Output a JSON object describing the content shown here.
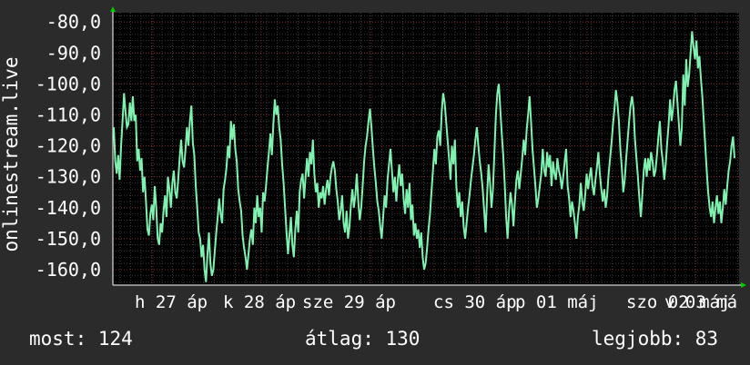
{
  "chart_data": {
    "type": "line",
    "ylabel": "onlinestream.live",
    "ylim": [
      -165,
      -77
    ],
    "y_ticks": [
      "-80,0",
      "-90,0",
      "-100,0",
      "-110,0",
      "-120,0",
      "-130,0",
      "-140,0",
      "-150,0",
      "-160,0"
    ],
    "y_tick_values": [
      -80,
      -90,
      -100,
      -110,
      -120,
      -130,
      -140,
      -150,
      -160
    ],
    "x_tick_labels": [
      "h 27 áp",
      "k 28 áp",
      "sze 29 áp",
      "cs 30 áp",
      "p 01 máj",
      "szo 02 máj",
      "v 03 má"
    ],
    "grid": true,
    "series": [
      {
        "color": "#7ff2b0",
        "values": [
          -114,
          -125,
          -129,
          -123,
          -131,
          -120,
          -112,
          -103,
          -109,
          -114,
          -113,
          -106,
          -112,
          -104,
          -112,
          -110,
          -125,
          -121,
          -128,
          -124,
          -135,
          -130,
          -138,
          -147,
          -149,
          -142,
          -139,
          -144,
          -133,
          -140,
          -150,
          -152,
          -145,
          -148,
          -141,
          -136,
          -143,
          -130,
          -134,
          -140,
          -132,
          -128,
          -135,
          -137,
          -131,
          -124,
          -118,
          -125,
          -127,
          -121,
          -114,
          -120,
          -112,
          -107,
          -119,
          -123,
          -133,
          -140,
          -148,
          -150,
          -156,
          -152,
          -160,
          -164,
          -155,
          -148,
          -158,
          -162,
          -160,
          -154,
          -148,
          -143,
          -137,
          -142,
          -145,
          -134,
          -131,
          -127,
          -120,
          -124,
          -112,
          -118,
          -113,
          -121,
          -125,
          -134,
          -138,
          -141,
          -149,
          -153,
          -156,
          -160,
          -155,
          -150,
          -147,
          -152,
          -140,
          -145,
          -136,
          -143,
          -140,
          -148,
          -135,
          -138,
          -133,
          -127,
          -122,
          -116,
          -123,
          -113,
          -105,
          -110,
          -107,
          -114,
          -118,
          -126,
          -132,
          -140,
          -148,
          -155,
          -149,
          -143,
          -152,
          -156,
          -147,
          -141,
          -148,
          -135,
          -131,
          -129,
          -137,
          -130,
          -124,
          -130,
          -122,
          -126,
          -118,
          -129,
          -135,
          -132,
          -140,
          -135,
          -137,
          -133,
          -139,
          -134,
          -131,
          -136,
          -130,
          -127,
          -125,
          -128,
          -134,
          -138,
          -144,
          -141,
          -136,
          -145,
          -148,
          -141,
          -150,
          -146,
          -139,
          -134,
          -140,
          -136,
          -129,
          -138,
          -144,
          -140,
          -133,
          -125,
          -120,
          -117,
          -112,
          -108,
          -114,
          -121,
          -127,
          -132,
          -138,
          -141,
          -146,
          -150,
          -143,
          -136,
          -140,
          -131,
          -126,
          -121,
          -128,
          -135,
          -130,
          -138,
          -131,
          -126,
          -133,
          -129,
          -137,
          -142,
          -134,
          -140,
          -132,
          -144,
          -139,
          -149,
          -145,
          -150,
          -147,
          -153,
          -148,
          -156,
          -160,
          -158,
          -153,
          -147,
          -142,
          -135,
          -128,
          -121,
          -126,
          -117,
          -115,
          -120,
          -109,
          -103,
          -106,
          -112,
          -118,
          -124,
          -131,
          -120,
          -126,
          -118,
          -133,
          -140,
          -135,
          -143,
          -138,
          -146,
          -150,
          -145,
          -140,
          -136,
          -131,
          -127,
          -123,
          -118,
          -114,
          -120,
          -125,
          -129,
          -134,
          -141,
          -148,
          -136,
          -126,
          -132,
          -140,
          -134,
          -122,
          -110,
          -103,
          -100,
          -108,
          -116,
          -123,
          -132,
          -143,
          -150,
          -141,
          -135,
          -139,
          -146,
          -138,
          -131,
          -128,
          -134,
          -129,
          -124,
          -118,
          -123,
          -115,
          -110,
          -104,
          -112,
          -121,
          -127,
          -133,
          -140,
          -137,
          -133,
          -129,
          -121,
          -128,
          -130,
          -122,
          -127,
          -123,
          -133,
          -125,
          -129,
          -131,
          -124,
          -128,
          -130,
          -134,
          -130,
          -125,
          -121,
          -133,
          -137,
          -143,
          -138,
          -141,
          -145,
          -150,
          -143,
          -139,
          -132,
          -138,
          -141,
          -136,
          -129,
          -134,
          -130,
          -127,
          -133,
          -136,
          -131,
          -127,
          -122,
          -129,
          -134,
          -138,
          -134,
          -140,
          -136,
          -129,
          -124,
          -119,
          -113,
          -108,
          -102,
          -106,
          -112,
          -121,
          -127,
          -135,
          -131,
          -124,
          -118,
          -112,
          -107,
          -104,
          -108,
          -118,
          -124,
          -130,
          -137,
          -143,
          -136,
          -128,
          -124,
          -130,
          -124,
          -128,
          -122,
          -125,
          -130,
          -128,
          -123,
          -117,
          -112,
          -121,
          -125,
          -131,
          -126,
          -119,
          -113,
          -105,
          -112,
          -108,
          -102,
          -99,
          -106,
          -113,
          -120,
          -114,
          -97,
          -107,
          -92,
          -101,
          -97,
          -90,
          -83,
          -88,
          -92,
          -86,
          -95,
          -91,
          -98,
          -104,
          -112,
          -120,
          -128,
          -135,
          -140,
          -143,
          -138,
          -145,
          -140,
          -136,
          -142,
          -138,
          -145,
          -140,
          -134,
          -139,
          -133,
          -128,
          -125,
          -120,
          -117,
          -124
        ]
      }
    ]
  },
  "footer": {
    "current": "most: 124",
    "average": "átlag: 130",
    "best": "legjobb: 83"
  },
  "colors": {
    "background": "#2b2b2b",
    "plot_area": "#000000",
    "line": "#7ff2b0",
    "grid_minor": "#3a3a3a",
    "grid_major": "#7a2a2a",
    "axis_arrow": "#00cc00"
  }
}
